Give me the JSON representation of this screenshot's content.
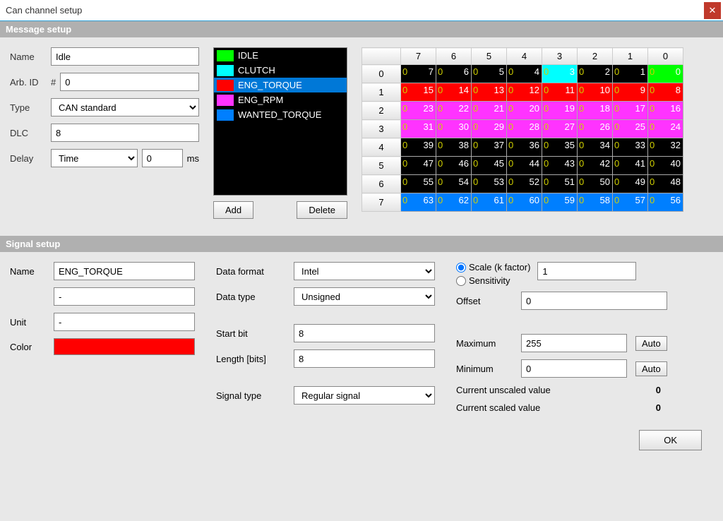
{
  "window": {
    "title": "Can channel setup"
  },
  "sections": {
    "message": "Message setup",
    "signal": "Signal setup"
  },
  "msg": {
    "labels": {
      "name": "Name",
      "arb": "Arb. ID",
      "arbhash": "#",
      "type": "Type",
      "dlc": "DLC",
      "delay": "Delay",
      "ms": "ms"
    },
    "name": "Idle",
    "arbid": "0",
    "type": "CAN standard",
    "dlc": "8",
    "delaymode": "Time",
    "delayval": "0"
  },
  "signals": [
    {
      "name": "IDLE",
      "color": "#00ff00"
    },
    {
      "name": "CLUTCH",
      "color": "#00ffff"
    },
    {
      "name": "ENG_TORQUE",
      "color": "#ff0000",
      "selected": true
    },
    {
      "name": "ENG_RPM",
      "color": "#ff33ff"
    },
    {
      "name": "WANTED_TORQUE",
      "color": "#007fff"
    }
  ],
  "buttons": {
    "add": "Add",
    "delete": "Delete",
    "auto": "Auto",
    "ok": "OK"
  },
  "grid": {
    "cols": [
      "7",
      "6",
      "5",
      "4",
      "3",
      "2",
      "1",
      "0"
    ],
    "rows": [
      "0",
      "1",
      "2",
      "3",
      "4",
      "5",
      "6",
      "7"
    ],
    "rowcolor": [
      "mix0",
      "red",
      "mag",
      "mag",
      "black",
      "black",
      "black",
      "blue"
    ],
    "baseleft": "0"
  },
  "sig": {
    "labels": {
      "name": "Name",
      "unit": "Unit",
      "color": "Color",
      "dformat": "Data format",
      "dtype": "Data type",
      "startbit": "Start bit",
      "length": "Length [bits]",
      "sigtype": "Signal type",
      "scale": "Scale (k factor)",
      "sens": "Sensitivity",
      "offset": "Offset",
      "max": "Maximum",
      "min": "Minimum",
      "curun": "Current unscaled value",
      "cursc": "Current scaled value"
    },
    "name": "ENG_TORQUE",
    "line2": "-",
    "unit": "-",
    "color": "#ff0000",
    "dformat": "Intel",
    "dtype": "Unsigned",
    "startbit": "8",
    "length": "8",
    "sigtype": "Regular signal",
    "scale": "1",
    "offset": "0",
    "max": "255",
    "min": "0",
    "curun": "0",
    "cursc": "0"
  }
}
